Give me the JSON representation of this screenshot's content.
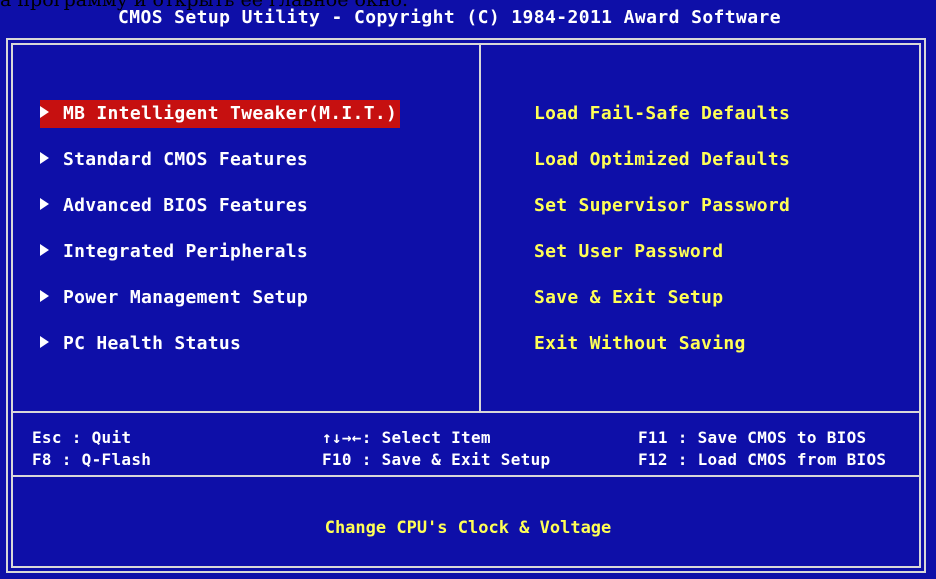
{
  "overlay_caption": "а программу и открыть ее главное окно.",
  "title": "CMOS Setup Utility - Copyright (C) 1984-2011 Award Software",
  "left_menu": [
    {
      "label": "MB Intelligent Tweaker(M.I.T.)",
      "selected": true
    },
    {
      "label": "Standard CMOS Features",
      "selected": false
    },
    {
      "label": "Advanced BIOS Features",
      "selected": false
    },
    {
      "label": "Integrated Peripherals",
      "selected": false
    },
    {
      "label": "Power Management Setup",
      "selected": false
    },
    {
      "label": "PC Health Status",
      "selected": false
    }
  ],
  "right_menu": [
    {
      "label": "Load Fail-Safe Defaults"
    },
    {
      "label": "Load Optimized Defaults"
    },
    {
      "label": "Set Supervisor Password"
    },
    {
      "label": "Set User Password"
    },
    {
      "label": "Save & Exit Setup"
    },
    {
      "label": "Exit Without Saving"
    }
  ],
  "help": {
    "row1": {
      "key1": "Esc : Quit",
      "key2": "↑↓→←: Select Item",
      "key3": "F11 : Save CMOS to BIOS"
    },
    "row2": {
      "key1": "F8  : Q-Flash",
      "key2": "F10 : Save & Exit Setup",
      "key3": "F12 : Load CMOS from BIOS"
    }
  },
  "status": "Change CPU's Clock & Voltage",
  "colors": {
    "background": "#0e0fa8",
    "highlight": "#c61010",
    "right_menu_text": "#ffff55",
    "status_text": "#ffff55"
  }
}
